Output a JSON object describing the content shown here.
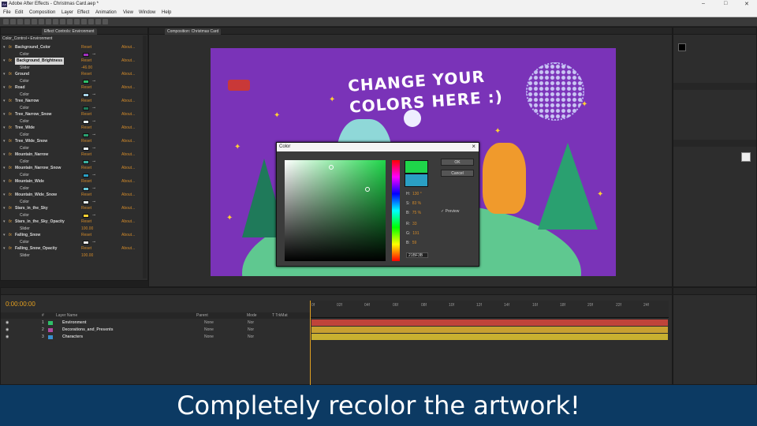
{
  "titlebar": {
    "app_title": "Adobe After Effects - Christmas Card.aep *",
    "logo": "Ae",
    "controls": [
      "–",
      "□",
      "✕"
    ]
  },
  "menubar": {
    "items": [
      "File",
      "Edit",
      "Composition",
      "Layer",
      "Effect",
      "Animation",
      "View",
      "Window",
      "Help"
    ]
  },
  "effect_controls": {
    "tab_label": "Effect Controls: Environment",
    "header": "Color_Control • Environment",
    "reset_label": "Reset",
    "about_label": "About...",
    "effects": [
      {
        "name": "Background_Color",
        "param": "Color",
        "kind": "color",
        "color": "#a02fbf"
      },
      {
        "name": "Background_Brightness",
        "param": "Slider",
        "kind": "slider",
        "value": "-46.00",
        "selected": true
      },
      {
        "name": "Ground",
        "param": "Color",
        "kind": "color",
        "color": "#2fbf6a"
      },
      {
        "name": "Road",
        "param": "Color",
        "kind": "color",
        "color": "#a8d4e8"
      },
      {
        "name": "Tree_Narrow",
        "param": "Color",
        "kind": "color",
        "color": "#1f7a5a"
      },
      {
        "name": "Tree_Narrow_Snow",
        "param": "Color",
        "kind": "color",
        "color": "#e8f4f8"
      },
      {
        "name": "Tree_Wide",
        "param": "Color",
        "kind": "color",
        "color": "#2aa070"
      },
      {
        "name": "Tree_Wide_Snow",
        "param": "Color",
        "kind": "color",
        "color": "#eaf6fa"
      },
      {
        "name": "Mountain_Narrow",
        "param": "Color",
        "kind": "color",
        "color": "#3ab0a0"
      },
      {
        "name": "Mountain_Narrow_Snow",
        "param": "Color",
        "kind": "color",
        "color": "#2a9fc4"
      },
      {
        "name": "Mountain_Wide",
        "param": "Color",
        "kind": "color",
        "color": "#6ac8d8"
      },
      {
        "name": "Mountain_Wide_Snow",
        "param": "Color",
        "kind": "color",
        "color": "#e8f4f8"
      },
      {
        "name": "Stars_in_the_Sky",
        "param": "Color",
        "kind": "color",
        "color": "#ffd234"
      },
      {
        "name": "Stars_in_the_Sky_Opacity",
        "param": "Slider",
        "kind": "slider",
        "value": "100.00"
      },
      {
        "name": "Falling_Snow",
        "param": "Color",
        "kind": "color",
        "color": "#f0f0f0"
      },
      {
        "name": "Falling_Snow_Opacity",
        "param": "Slider",
        "kind": "slider",
        "value": "100.00"
      }
    ]
  },
  "composition": {
    "tab_label": "Composition: Christmas Card",
    "canvas_text_line1": "CHANGE YOUR",
    "canvas_text_line2": "COLORS HERE :)"
  },
  "color_dialog": {
    "title": "Color",
    "ok_label": "OK",
    "cancel_label": "Cancel",
    "preview_label": "Preview",
    "fields": [
      {
        "label": "H:",
        "value": "130 °"
      },
      {
        "label": "S:",
        "value": "83 %"
      },
      {
        "label": "B:",
        "value": "75 %"
      },
      {
        "label": "R:",
        "value": "33"
      },
      {
        "label": "G:",
        "value": "191"
      },
      {
        "label": "B:",
        "value": "59"
      }
    ],
    "hex": "21BF3B",
    "new_color": "#1fd64a",
    "old_color": "#2a9fc4"
  },
  "timeline": {
    "timecode": "0:00:00:00",
    "header": {
      "num": "#",
      "layer_name": "Layer Name",
      "parent": "Parent",
      "mode": "Mode",
      "trkmat": "T TrkMat"
    },
    "ruler_ticks": [
      "0f",
      "02f",
      "04f",
      "06f",
      "08f",
      "10f",
      "12f",
      "14f",
      "16f",
      "18f",
      "20f",
      "22f",
      "24f"
    ],
    "layers": [
      {
        "num": "1",
        "name": "Environment",
        "label": "#2fbf6a",
        "parent": "None",
        "mode": "Nor",
        "bar": "#c0443a"
      },
      {
        "num": "2",
        "name": "Decorations_and_Presents",
        "label": "#b04aa0",
        "parent": "None",
        "mode": "Nor",
        "bar": "#c8a030"
      },
      {
        "num": "3",
        "name": "Characters",
        "label": "#3a90d0",
        "parent": "None",
        "mode": "Nor",
        "bar": "#c8b030"
      }
    ]
  },
  "subtitle": "Completely recolor the artwork!"
}
